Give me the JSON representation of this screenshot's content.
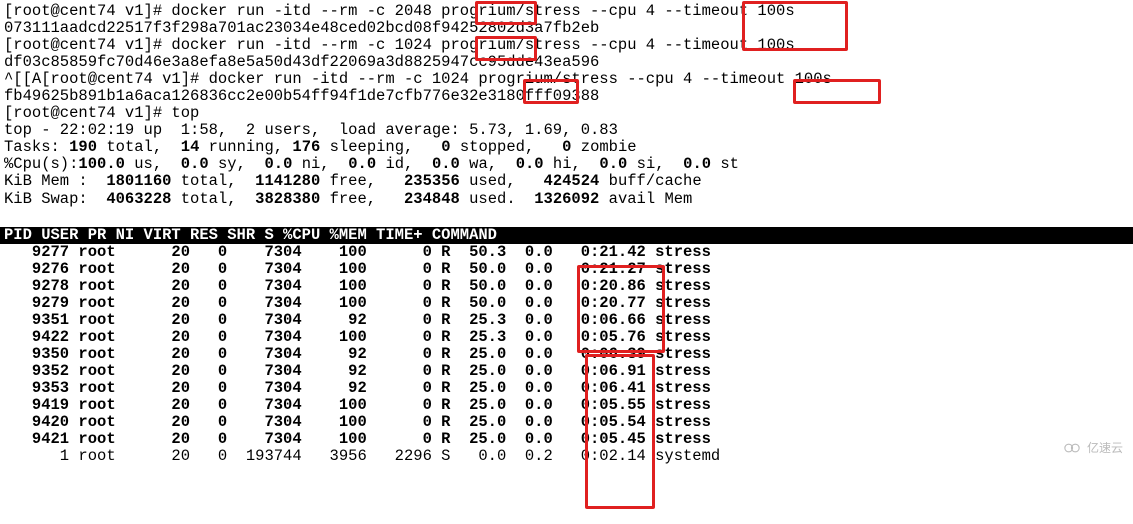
{
  "prompts": [
    {
      "user": "root",
      "host": "cent74",
      "cwd": "v1",
      "cmd_pre": "docker run -itd --rm -c",
      "c_val": "2048",
      "cmd_mid": "progrium/stress",
      "cpu_flag": "--cpu 4",
      "cmd_post": "--timeout 100s",
      "hash": "073111aadcd22517f3f298a701ac23034e48ced02bcd08f94252802d3a7fb2eb",
      "pre": ""
    },
    {
      "user": "root",
      "host": "cent74",
      "cwd": "v1",
      "cmd_pre": "docker run -itd --rm -c",
      "c_val": "1024",
      "cmd_mid": "progrium/stress",
      "cpu_flag": "--cpu 4",
      "cmd_post": "--timeout 100s",
      "hash": "df03c85859fc70d46e3a8efa8e5a50d43df22069a3d8825947cc95dde43ea596",
      "pre": ""
    },
    {
      "user": "root",
      "host": "cent74",
      "cwd": "v1",
      "cmd_pre": "docker run -itd --rm -c",
      "c_val": "1024",
      "cmd_mid": "progrium/stress",
      "cpu_flag": "--cpu 4",
      "cmd_post": "--timeout 100s",
      "hash": "fb49625b891b1a6aca126836cc2e00b54ff94f1de7cfb776e32e3180fff09388",
      "pre": "^[[A"
    }
  ],
  "top_cmd": {
    "user": "root",
    "host": "cent74",
    "cwd": "v1",
    "cmd": "top"
  },
  "top_summary": {
    "line1": "top - 22:02:19 up  1:58,  2 users,  load average: 5.73, 1.69, 0.83",
    "tasks": {
      "total": "190",
      "running": "14",
      "sleeping": "176",
      "stopped": "0",
      "zombie": "0"
    },
    "cpu": {
      "us": "100.0",
      "sy": "0.0",
      "ni": "0.0",
      "id": "0.0",
      "wa": "0.0",
      "hi": "0.0",
      "si": "0.0",
      "st": "0.0"
    },
    "mem": {
      "total": "1801160",
      "free": "1141280",
      "used": "235356",
      "buff": "424524"
    },
    "swap": {
      "total": "4063228",
      "free": "3828380",
      "used": "234848",
      "avail": "1326092"
    }
  },
  "columns": "    PID USER      PR  NI    VIRT    RES    SHR S  %CPU %MEM     TIME+ COMMAND                            ",
  "processes": [
    {
      "pid": "9277",
      "user": "root",
      "pr": "20",
      "ni": "0",
      "virt": "7304",
      "res": "100",
      "shr": "0",
      "s": "R",
      "cpu": "50.3",
      "mem": "0.0",
      "time": "0:21.42",
      "cmd": "stress"
    },
    {
      "pid": "9276",
      "user": "root",
      "pr": "20",
      "ni": "0",
      "virt": "7304",
      "res": "100",
      "shr": "0",
      "s": "R",
      "cpu": "50.0",
      "mem": "0.0",
      "time": "0:21.27",
      "cmd": "stress"
    },
    {
      "pid": "9278",
      "user": "root",
      "pr": "20",
      "ni": "0",
      "virt": "7304",
      "res": "100",
      "shr": "0",
      "s": "R",
      "cpu": "50.0",
      "mem": "0.0",
      "time": "0:20.86",
      "cmd": "stress"
    },
    {
      "pid": "9279",
      "user": "root",
      "pr": "20",
      "ni": "0",
      "virt": "7304",
      "res": "100",
      "shr": "0",
      "s": "R",
      "cpu": "50.0",
      "mem": "0.0",
      "time": "0:20.77",
      "cmd": "stress"
    },
    {
      "pid": "9351",
      "user": "root",
      "pr": "20",
      "ni": "0",
      "virt": "7304",
      "res": "92",
      "shr": "0",
      "s": "R",
      "cpu": "25.3",
      "mem": "0.0",
      "time": "0:06.66",
      "cmd": "stress"
    },
    {
      "pid": "9422",
      "user": "root",
      "pr": "20",
      "ni": "0",
      "virt": "7304",
      "res": "100",
      "shr": "0",
      "s": "R",
      "cpu": "25.3",
      "mem": "0.0",
      "time": "0:05.76",
      "cmd": "stress"
    },
    {
      "pid": "9350",
      "user": "root",
      "pr": "20",
      "ni": "0",
      "virt": "7304",
      "res": "92",
      "shr": "0",
      "s": "R",
      "cpu": "25.0",
      "mem": "0.0",
      "time": "0:06.39",
      "cmd": "stress"
    },
    {
      "pid": "9352",
      "user": "root",
      "pr": "20",
      "ni": "0",
      "virt": "7304",
      "res": "92",
      "shr": "0",
      "s": "R",
      "cpu": "25.0",
      "mem": "0.0",
      "time": "0:06.91",
      "cmd": "stress"
    },
    {
      "pid": "9353",
      "user": "root",
      "pr": "20",
      "ni": "0",
      "virt": "7304",
      "res": "92",
      "shr": "0",
      "s": "R",
      "cpu": "25.0",
      "mem": "0.0",
      "time": "0:06.41",
      "cmd": "stress"
    },
    {
      "pid": "9419",
      "user": "root",
      "pr": "20",
      "ni": "0",
      "virt": "7304",
      "res": "100",
      "shr": "0",
      "s": "R",
      "cpu": "25.0",
      "mem": "0.0",
      "time": "0:05.55",
      "cmd": "stress"
    },
    {
      "pid": "9420",
      "user": "root",
      "pr": "20",
      "ni": "0",
      "virt": "7304",
      "res": "100",
      "shr": "0",
      "s": "R",
      "cpu": "25.0",
      "mem": "0.0",
      "time": "0:05.54",
      "cmd": "stress"
    },
    {
      "pid": "9421",
      "user": "root",
      "pr": "20",
      "ni": "0",
      "virt": "7304",
      "res": "100",
      "shr": "0",
      "s": "R",
      "cpu": "25.0",
      "mem": "0.0",
      "time": "0:05.45",
      "cmd": "stress"
    },
    {
      "pid": "1",
      "user": "root",
      "pr": "20",
      "ni": "0",
      "virt": "193744",
      "res": "3956",
      "shr": "2296",
      "s": "S",
      "cpu": "0.0",
      "mem": "0.2",
      "time": "0:02.14",
      "cmd": "systemd"
    }
  ],
  "watermark": "亿速云"
}
